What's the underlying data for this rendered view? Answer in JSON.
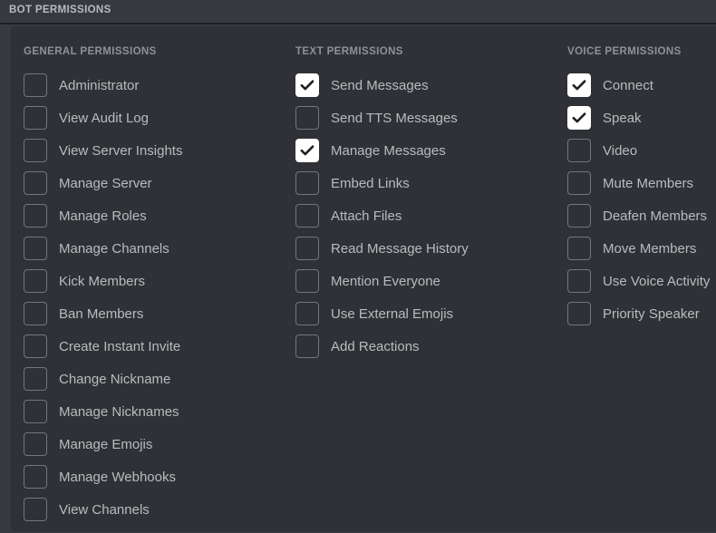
{
  "topbar": {
    "title": "BOT PERMISSIONS"
  },
  "colors": {
    "window_background": "#36393f",
    "panel_background": "#2f3136",
    "panel_border": "#3a3d43",
    "divider": "#1e2124",
    "header_text": "#8e9297",
    "label_text": "#b9bbbe",
    "checkbox_border": "#72767d",
    "checkbox_checked_fill": "#ffffff",
    "checkmark": "#1e2124"
  },
  "columns": [
    {
      "key": "general",
      "header": "GENERAL PERMISSIONS",
      "items": [
        {
          "label": "Administrator",
          "checked": false
        },
        {
          "label": "View Audit Log",
          "checked": false
        },
        {
          "label": "View Server Insights",
          "checked": false
        },
        {
          "label": "Manage Server",
          "checked": false
        },
        {
          "label": "Manage Roles",
          "checked": false
        },
        {
          "label": "Manage Channels",
          "checked": false
        },
        {
          "label": "Kick Members",
          "checked": false
        },
        {
          "label": "Ban Members",
          "checked": false
        },
        {
          "label": "Create Instant Invite",
          "checked": false
        },
        {
          "label": "Change Nickname",
          "checked": false
        },
        {
          "label": "Manage Nicknames",
          "checked": false
        },
        {
          "label": "Manage Emojis",
          "checked": false
        },
        {
          "label": "Manage Webhooks",
          "checked": false
        },
        {
          "label": "View Channels",
          "checked": false
        }
      ]
    },
    {
      "key": "text",
      "header": "TEXT PERMISSIONS",
      "items": [
        {
          "label": "Send Messages",
          "checked": true
        },
        {
          "label": "Send TTS Messages",
          "checked": false
        },
        {
          "label": "Manage Messages",
          "checked": true
        },
        {
          "label": "Embed Links",
          "checked": false
        },
        {
          "label": "Attach Files",
          "checked": false
        },
        {
          "label": "Read Message History",
          "checked": false
        },
        {
          "label": "Mention Everyone",
          "checked": false
        },
        {
          "label": "Use External Emojis",
          "checked": false
        },
        {
          "label": "Add Reactions",
          "checked": false
        }
      ]
    },
    {
      "key": "voice",
      "header": "VOICE PERMISSIONS",
      "items": [
        {
          "label": "Connect",
          "checked": true
        },
        {
          "label": "Speak",
          "checked": true
        },
        {
          "label": "Video",
          "checked": false
        },
        {
          "label": "Mute Members",
          "checked": false
        },
        {
          "label": "Deafen Members",
          "checked": false
        },
        {
          "label": "Move Members",
          "checked": false
        },
        {
          "label": "Use Voice Activity",
          "checked": false
        },
        {
          "label": "Priority Speaker",
          "checked": false
        }
      ]
    }
  ]
}
